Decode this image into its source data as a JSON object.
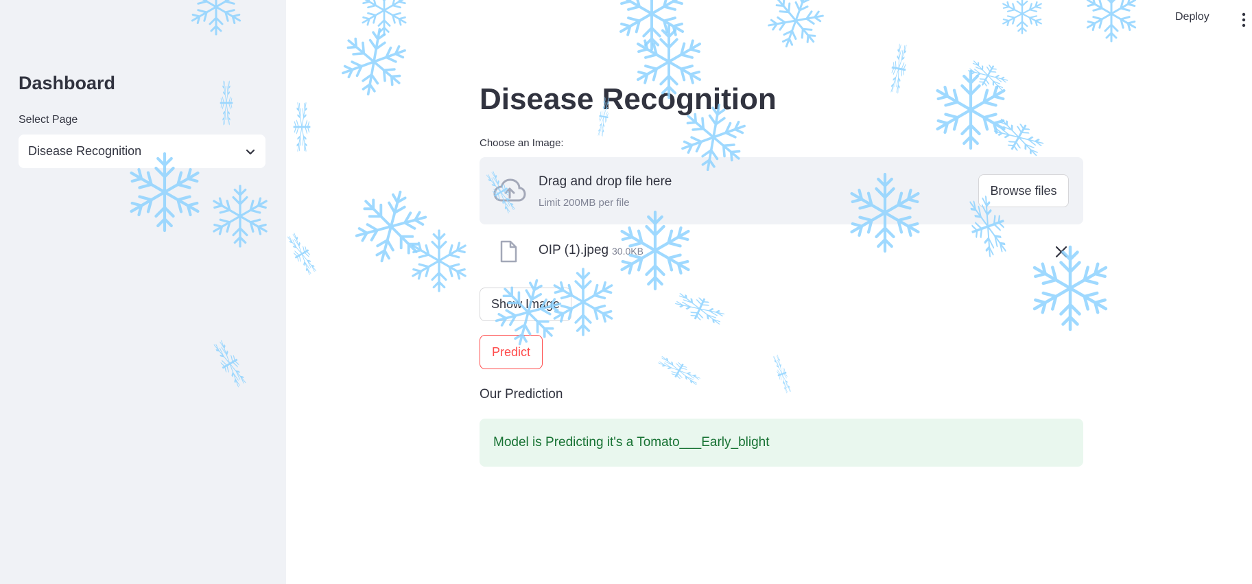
{
  "topbar": {
    "deploy_label": "Deploy",
    "menu_icon": "kebab-menu-icon"
  },
  "sidebar": {
    "title": "Dashboard",
    "select_label": "Select Page",
    "select_value": "Disease Recognition",
    "select_icon": "chevron-down-icon"
  },
  "main": {
    "title": "Disease Recognition",
    "uploader": {
      "label": "Choose an Image:",
      "drop_text": "Drag and drop file here",
      "limit_text": "Limit 200MB per file",
      "browse_label": "Browse files",
      "icon": "cloud-upload-icon"
    },
    "file": {
      "name": "OIP (1).jpeg",
      "size": "30.0KB",
      "icon": "file-icon",
      "remove_icon": "close-icon"
    },
    "show_image_label": "Show Image",
    "predict_label": "Predict",
    "prediction_heading": "Our Prediction",
    "prediction_text": "Model is Predicting it's a Tomato___Early_blight"
  },
  "colors": {
    "sidebar_bg": "#f0f2f6",
    "primary": "#ff4b4b",
    "success_bg": "#e9f7ee",
    "success_text": "#177233",
    "snowflake": "#7fd0ff"
  },
  "decoration": {
    "snow_icon": "snowflake-icon"
  }
}
